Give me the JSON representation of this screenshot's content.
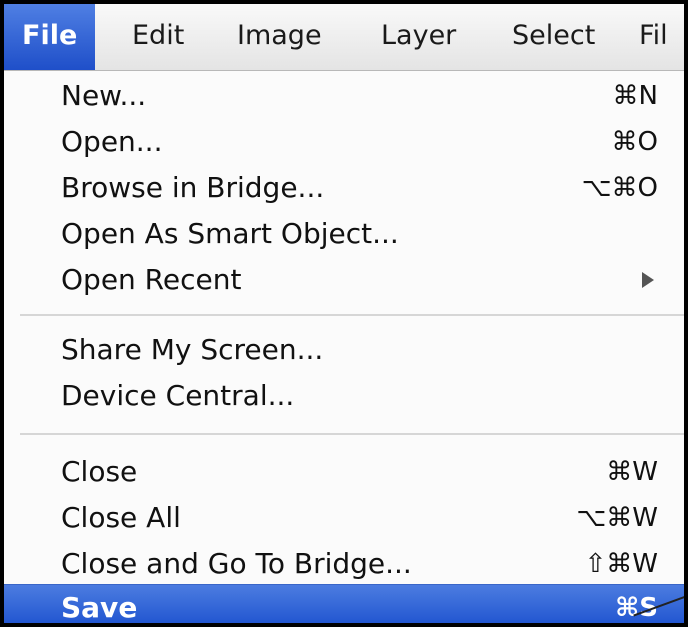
{
  "menubar": {
    "items": [
      {
        "label": "File",
        "active": true
      },
      {
        "label": "Edit"
      },
      {
        "label": "Image"
      },
      {
        "label": "Layer"
      },
      {
        "label": "Select"
      },
      {
        "label": "Fil"
      }
    ]
  },
  "menu": {
    "items": [
      {
        "label": "New...",
        "shortcut": "⌘N"
      },
      {
        "label": "Open...",
        "shortcut": "⌘O"
      },
      {
        "label": "Browse in Bridge...",
        "shortcut": "⌥⌘O"
      },
      {
        "label": "Open As Smart Object...",
        "shortcut": ""
      },
      {
        "label": "Open Recent",
        "shortcut": "",
        "submenu_icon": "chevron-right-icon"
      },
      {
        "label": "Share My Screen...",
        "shortcut": ""
      },
      {
        "label": "Device Central...",
        "shortcut": ""
      },
      {
        "label": "Close",
        "shortcut": "⌘W"
      },
      {
        "label": "Close All",
        "shortcut": "⌥⌘W"
      },
      {
        "label": "Close and Go To Bridge...",
        "shortcut": "⇧⌘W"
      },
      {
        "label": "Save",
        "shortcut": "⌘S",
        "highlighted": true
      }
    ]
  },
  "colors": {
    "highlight": "#2a5bd4",
    "menu_background": "#fbfbfb",
    "separator": "#d6d6d6"
  }
}
